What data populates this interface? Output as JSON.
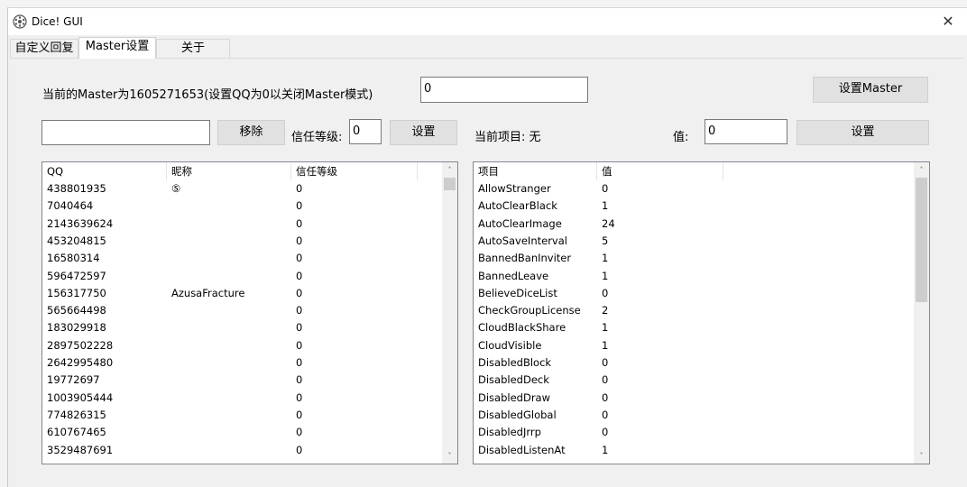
{
  "window": {
    "title": "Dice! GUI",
    "close_glyph": "✕"
  },
  "tabs": [
    {
      "label": "自定义回复"
    },
    {
      "label": "Master设置"
    },
    {
      "label": "关于"
    }
  ],
  "master": {
    "current_label": "当前的Master为1605271653(设置QQ为0以关闭Master模式)",
    "qq_input_value": "0",
    "set_button": "设置Master"
  },
  "trust": {
    "qq_input_value": "",
    "remove_button": "移除",
    "level_label": "信任等级:",
    "level_value": "0",
    "set_button": "设置"
  },
  "config": {
    "current_item_label": "当前项目: 无",
    "value_label": "值:",
    "value_input": "0",
    "set_button": "设置"
  },
  "left_list": {
    "columns": [
      "QQ",
      "昵称",
      "信任等级"
    ],
    "rows": [
      [
        "438801935",
        "⑤",
        "0"
      ],
      [
        "7040464",
        "",
        "0"
      ],
      [
        "2143639624",
        "",
        "0"
      ],
      [
        "453204815",
        "",
        "0"
      ],
      [
        "16580314",
        "",
        "0"
      ],
      [
        "596472597",
        "",
        "0"
      ],
      [
        "156317750",
        "AzusaFracture",
        "0"
      ],
      [
        "565664498",
        "",
        "0"
      ],
      [
        "183029918",
        "",
        "0"
      ],
      [
        "2897502228",
        "",
        "0"
      ],
      [
        "2642995480",
        "",
        "0"
      ],
      [
        "19772697",
        "",
        "0"
      ],
      [
        "1003905444",
        "",
        "0"
      ],
      [
        "774826315",
        "",
        "0"
      ],
      [
        "610767465",
        "",
        "0"
      ],
      [
        "3529487691",
        "",
        "0"
      ]
    ]
  },
  "right_list": {
    "columns": [
      "项目",
      "值"
    ],
    "rows": [
      [
        "AllowStranger",
        "0"
      ],
      [
        "AutoClearBlack",
        "1"
      ],
      [
        "AutoClearImage",
        "24"
      ],
      [
        "AutoSaveInterval",
        "5"
      ],
      [
        "BannedBanInviter",
        "1"
      ],
      [
        "BannedLeave",
        "1"
      ],
      [
        "BelieveDiceList",
        "0"
      ],
      [
        "CheckGroupLicense",
        "2"
      ],
      [
        "CloudBlackShare",
        "1"
      ],
      [
        "CloudVisible",
        "1"
      ],
      [
        "DisabledBlock",
        "0"
      ],
      [
        "DisabledDeck",
        "0"
      ],
      [
        "DisabledDraw",
        "0"
      ],
      [
        "DisabledGlobal",
        "0"
      ],
      [
        "DisabledJrrp",
        "0"
      ],
      [
        "DisabledListenAt",
        "1"
      ]
    ]
  },
  "scroll": {
    "up_glyph": "˄",
    "down_glyph": "˅"
  }
}
